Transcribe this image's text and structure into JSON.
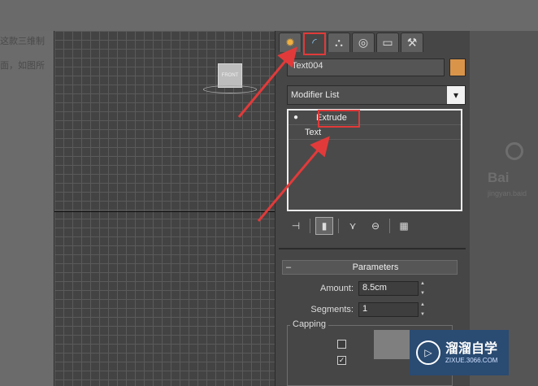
{
  "background": {
    "line1": "这款三维制",
    "line2": "面，如图所",
    "brand": "Bai",
    "brand_sub": "jingyan.baid"
  },
  "viewport": {
    "cube_label": "FRONT"
  },
  "panel": {
    "tabs": [
      {
        "icon": "create-icon",
        "glyph": "✹"
      },
      {
        "icon": "modify-icon",
        "glyph": "◜"
      },
      {
        "icon": "hierarchy-icon",
        "glyph": "⛬"
      },
      {
        "icon": "motion-icon",
        "glyph": "◎"
      },
      {
        "icon": "display-icon",
        "glyph": "▭"
      },
      {
        "icon": "utilities-icon",
        "glyph": "⚒"
      }
    ],
    "object_name": "Text004",
    "object_color": "#d9944a",
    "modifier_list": "Modifier List",
    "stack": {
      "top_item": "Extrude",
      "base_item": "Text"
    },
    "parameters": {
      "title": "Parameters",
      "amount_label": "Amount:",
      "amount_value": "8.5cm",
      "segments_label": "Segments:",
      "segments_value": "1",
      "capping_label": "Capping"
    }
  },
  "watermark": {
    "title": "溜溜自学",
    "url": "ZIXUE.3066.COM"
  }
}
